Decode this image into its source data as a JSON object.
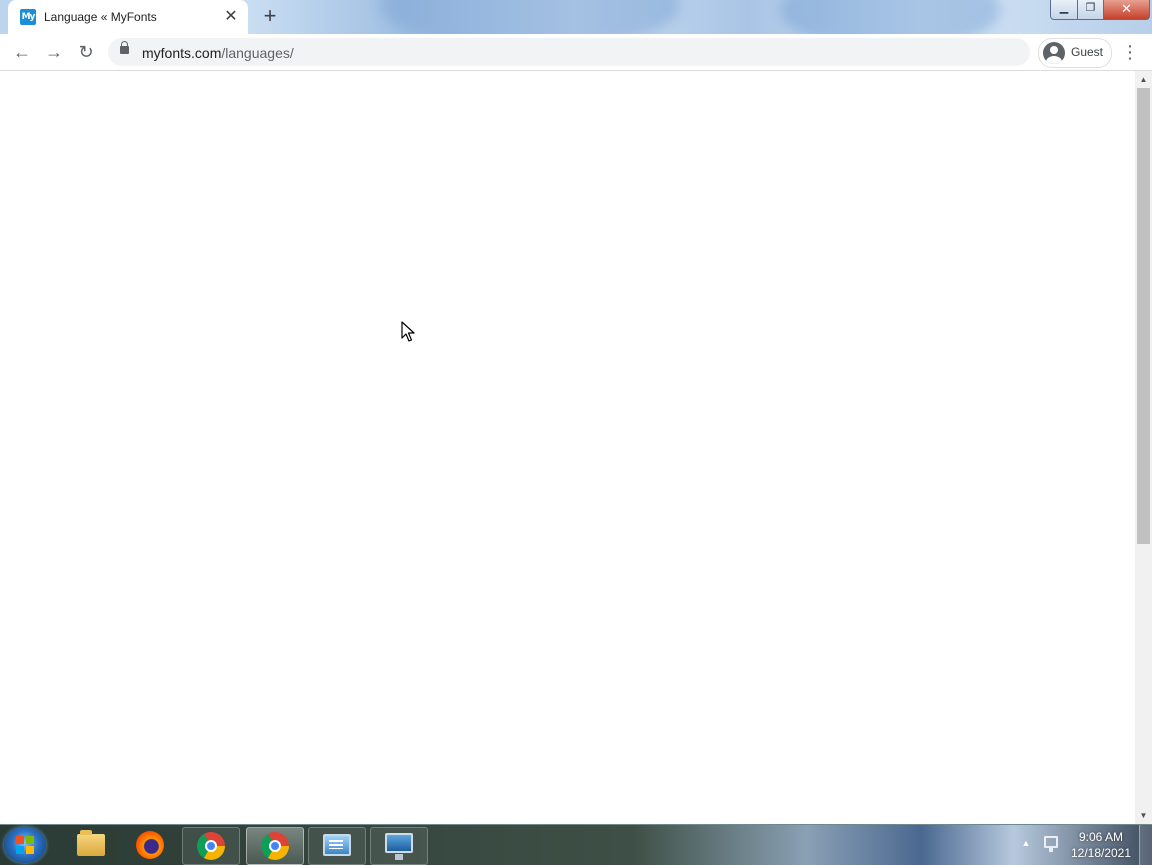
{
  "browser": {
    "tab": {
      "title": "Language « MyFonts",
      "favicon_text": "My",
      "close_glyph": "✕"
    },
    "new_tab_glyph": "+",
    "window_controls": {
      "minimize": "▁",
      "maximize": "❐",
      "close": "✕"
    },
    "toolbar": {
      "back_glyph": "←",
      "forward_glyph": "→",
      "reload_glyph": "↻",
      "url_domain": "myfonts.com",
      "url_path": "/languages/",
      "profile_label": "Guest",
      "menu_glyph": "⋮"
    }
  },
  "page": {
    "state": "blank"
  },
  "scrollbar": {
    "up_glyph": "▲",
    "down_glyph": "▼"
  },
  "taskbar": {
    "pinned": [
      "windows-explorer",
      "firefox",
      "chrome",
      "chrome-active",
      "control-tool",
      "remote-desktop"
    ],
    "tray_arrow_glyph": "▲",
    "clock_time": "9:06 AM",
    "clock_date": "12/18/2021"
  },
  "colors": {
    "accent": "#1a8fd6",
    "toolbar_bg": "#ffffff",
    "omnibox_bg": "#f1f3f4"
  }
}
